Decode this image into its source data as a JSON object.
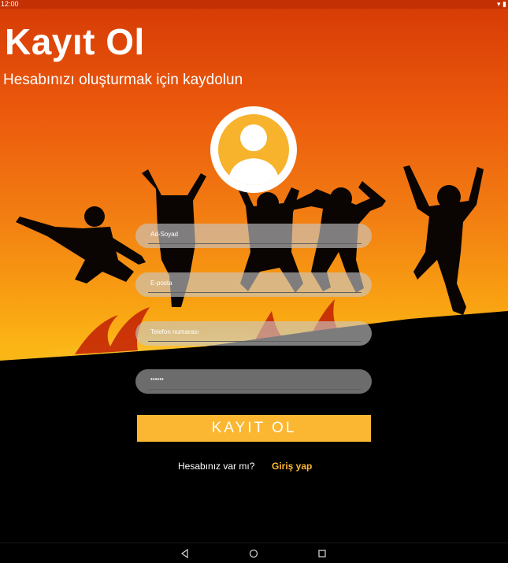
{
  "status_bar": {
    "time": "12:00",
    "icons": [
      "wifi-icon",
      "battery-icon"
    ]
  },
  "header": {
    "title": "Kayıt Ol",
    "subtitle": "Hesabınızı oluşturmak için kaydolun"
  },
  "form": {
    "name_placeholder": "Ad-Soyad",
    "email_placeholder": "E-posta",
    "phone_placeholder": "Telefon numarası",
    "password_value": "••••••",
    "submit_label": "KAYIT OL"
  },
  "footer": {
    "question": "Hesabınız var mı?",
    "login_link": "Giriş yap"
  },
  "nav": {
    "icons": [
      "back-icon",
      "home-icon",
      "recents-icon"
    ]
  },
  "colors": {
    "accent": "#fbb731",
    "sky_top": "#d53a05",
    "sky_bottom": "#fbb615"
  }
}
